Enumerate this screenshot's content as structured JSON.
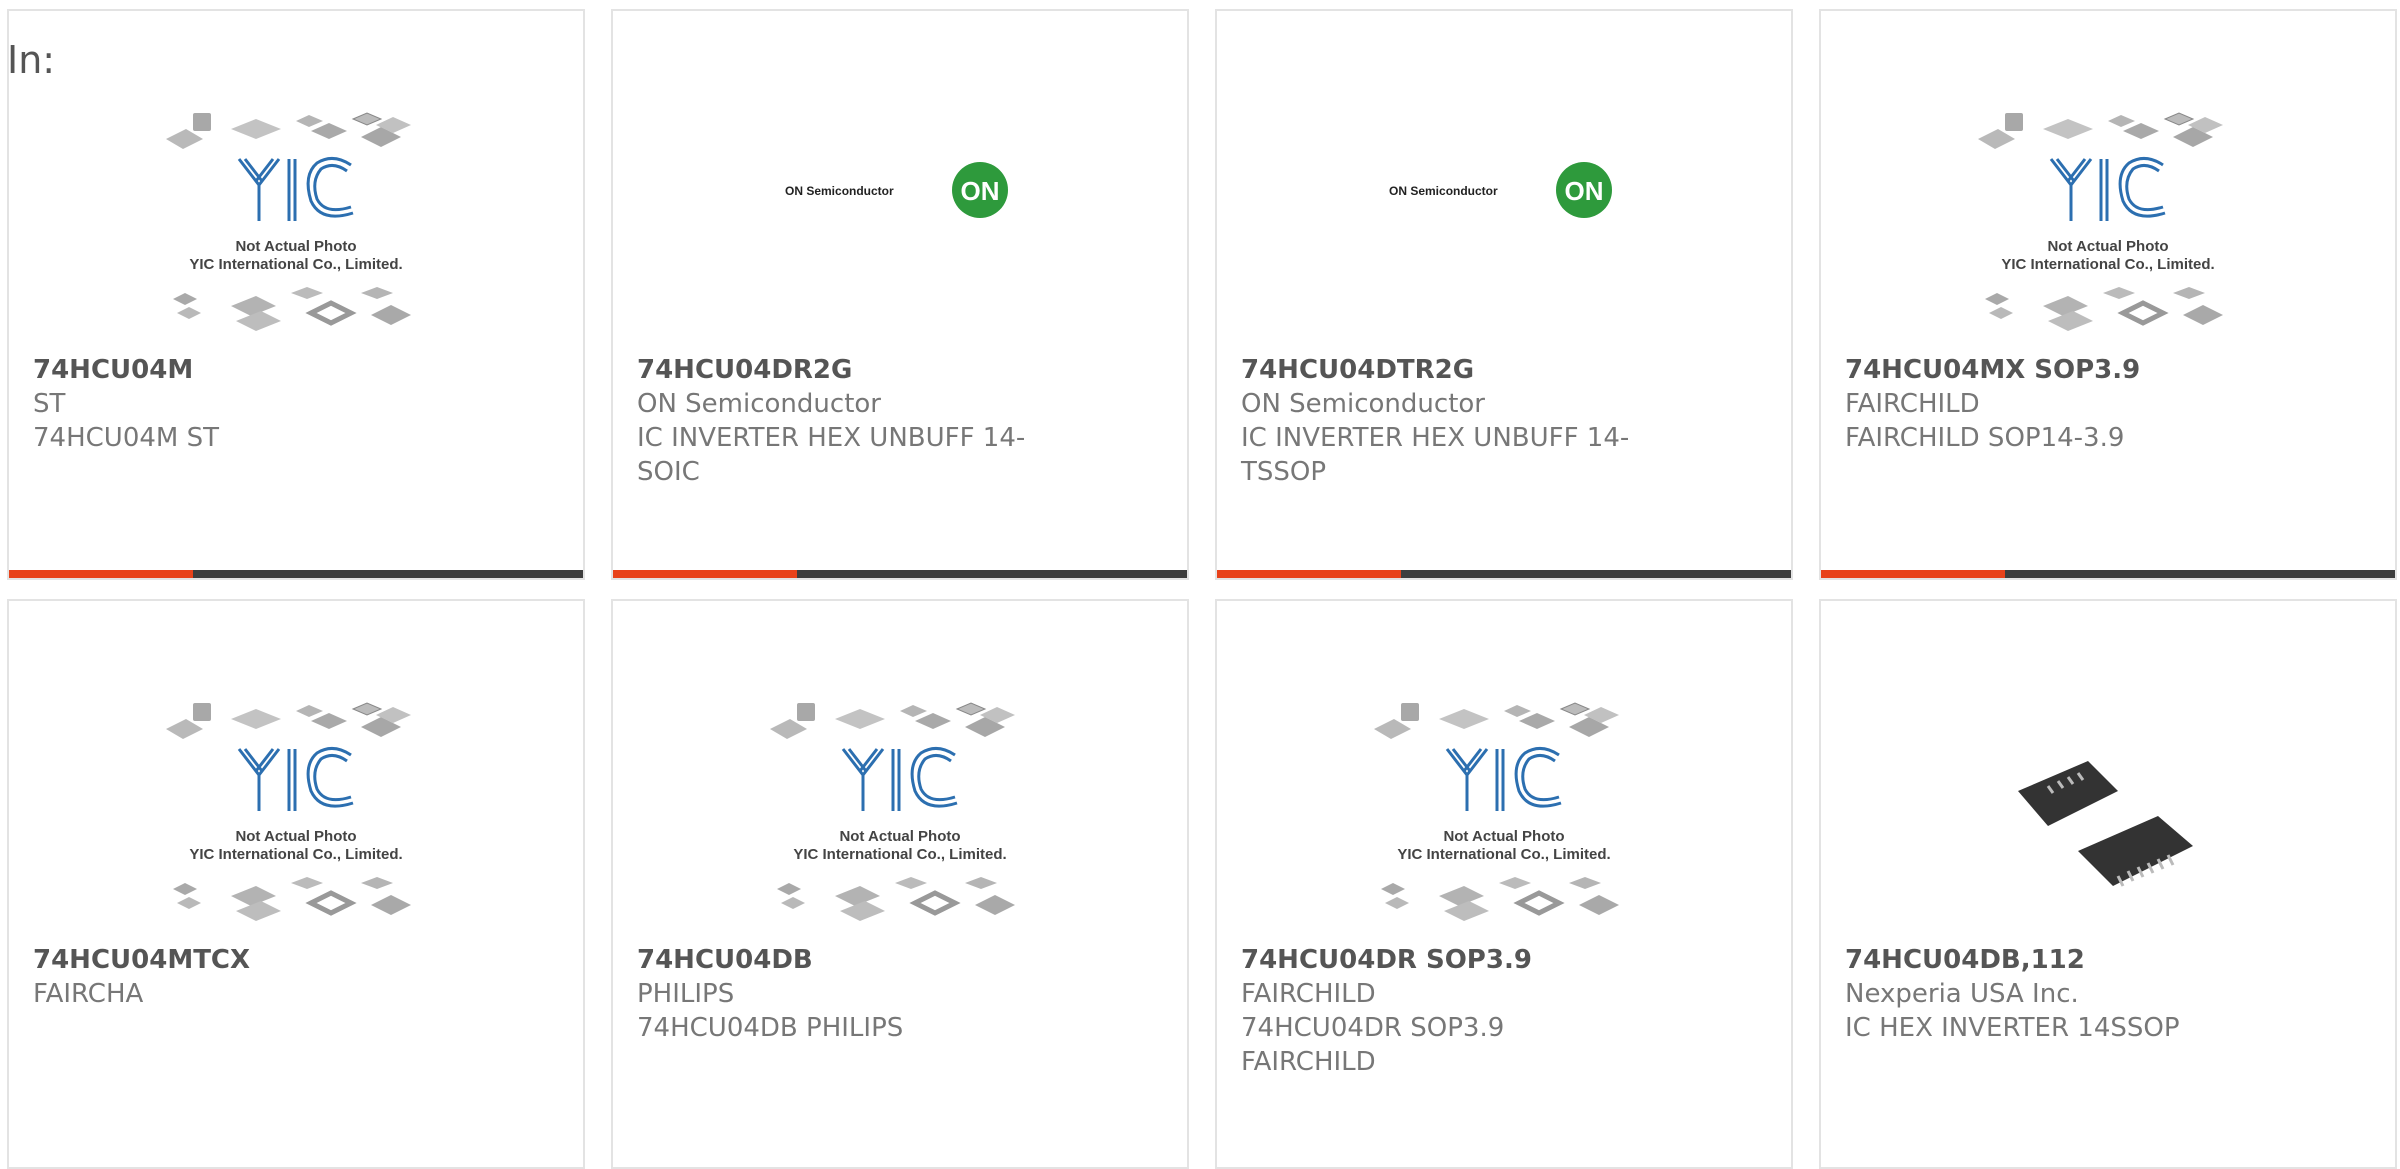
{
  "filter_label": "In:",
  "photo_text": {
    "line1": "Not Actual Photo",
    "line2": "YIC International Co., Limited.",
    "logo": "YIC"
  },
  "on_logo_text": "ON Semiconductor",
  "on_badge": "ON",
  "colors": {
    "accent": "#e8421a",
    "bar": "#3d3d3d",
    "on_green": "#2e9a3c"
  },
  "products": [
    {
      "part": "74HCU04M",
      "maker": "ST",
      "desc": "74HCU04M ST",
      "image": "yic-placeholder"
    },
    {
      "part": "74HCU04DR2G",
      "maker": "ON Semiconductor",
      "desc": "IC INVERTER HEX UNBUFF 14-SOIC",
      "image": "on-semiconductor-logo"
    },
    {
      "part": "74HCU04DTR2G",
      "maker": "ON Semiconductor",
      "desc": "IC INVERTER HEX UNBUFF 14-TSSOP",
      "image": "on-semiconductor-logo"
    },
    {
      "part": "74HCU04MX SOP3.9",
      "maker": "FAIRCHILD",
      "desc": "FAIRCHILD SOP14-3.9",
      "image": "yic-placeholder"
    },
    {
      "part": "74HCU04MTCX",
      "maker": "FAIRCHA",
      "desc": "",
      "image": "yic-placeholder"
    },
    {
      "part": "74HCU04DB",
      "maker": "PHILIPS",
      "desc": "74HCU04DB PHILIPS",
      "image": "yic-placeholder"
    },
    {
      "part": "74HCU04DR SOP3.9",
      "maker": "FAIRCHILD",
      "desc": "74HCU04DR SOP3.9 FAIRCHILD",
      "image": "yic-placeholder"
    },
    {
      "part": "74HCU04DB,112",
      "maker": "Nexperia USA Inc.",
      "desc": "IC HEX INVERTER 14SSOP",
      "image": "chip-photo"
    }
  ]
}
